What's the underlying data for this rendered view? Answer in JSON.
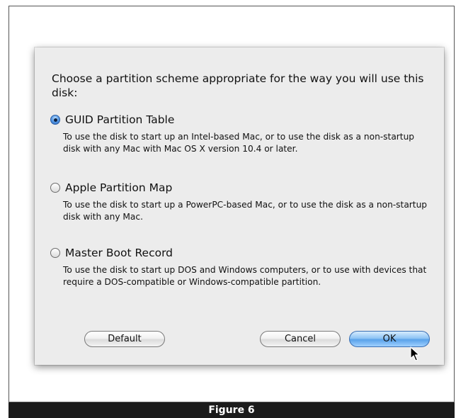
{
  "dialog": {
    "prompt": "Choose a partition scheme appropriate for the way you will use this disk:",
    "options": [
      {
        "label": "GUID Partition Table",
        "description": "To use the disk to start up an Intel-based Mac, or to use the disk as a non-startup disk with any Mac with Mac OS X version 10.4 or later.",
        "selected": true
      },
      {
        "label": "Apple Partition Map",
        "description": "To use the disk to start up a PowerPC-based Mac, or to use the disk as a non-startup disk with any Mac.",
        "selected": false
      },
      {
        "label": "Master Boot Record",
        "description": "To use the disk to start up DOS and Windows computers, or to use with devices that require a DOS-compatible or Windows-compatible partition.",
        "selected": false
      }
    ],
    "buttons": {
      "default_label": "Default",
      "cancel_label": "Cancel",
      "ok_label": "OK"
    },
    "accent_color": "#5aa2ea"
  },
  "caption": "Figure 6",
  "icons": {
    "selected_radio": "radio-selected-icon",
    "radio": "radio-icon",
    "cursor": "mouse-pointer-icon"
  }
}
